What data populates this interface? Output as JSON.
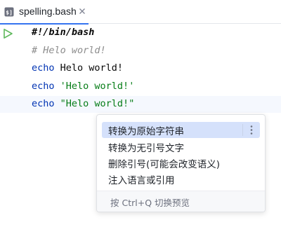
{
  "tab": {
    "filename": "spelling.bash",
    "file_icon": "terminal-file-icon",
    "close_icon": "close-icon"
  },
  "editor": {
    "run_icon": "run-icon",
    "lines": [
      {
        "parts": [
          {
            "text": "#!/bin/bash",
            "style": "shebang"
          }
        ]
      },
      {
        "parts": [
          {
            "text": "# Helo world!",
            "style": "cmt"
          }
        ]
      },
      {
        "parts": [
          {
            "text": "echo",
            "style": "kw"
          },
          {
            "text": " Helo world!",
            "style": "plain"
          }
        ]
      },
      {
        "parts": [
          {
            "text": "echo",
            "style": "kw"
          },
          {
            "text": " ",
            "style": "plain"
          },
          {
            "text": "'Helo world!'",
            "style": "str"
          }
        ]
      },
      {
        "parts": [
          {
            "text": "echo",
            "style": "kw"
          },
          {
            "text": " ",
            "style": "plain"
          },
          {
            "text": "\"Helo world!\"",
            "style": "str"
          }
        ]
      }
    ],
    "current_line": 4
  },
  "popup": {
    "items": [
      {
        "label": "转换为原始字符串",
        "selected": true
      },
      {
        "label": "转换为无引号文字",
        "selected": false
      },
      {
        "label": "删除引号(可能会改变语义)",
        "selected": false
      },
      {
        "label": "注入语言或引用",
        "selected": false
      }
    ],
    "more_icon": "more-vertical-icon",
    "footer": "按 Ctrl+Q 切换预览"
  },
  "colors": {
    "keyword": "#0033b3",
    "string": "#067d17",
    "comment": "#8c8c8c",
    "selection": "#d5e1fb",
    "run": "#5fb85c",
    "accent": "#3574f0"
  }
}
